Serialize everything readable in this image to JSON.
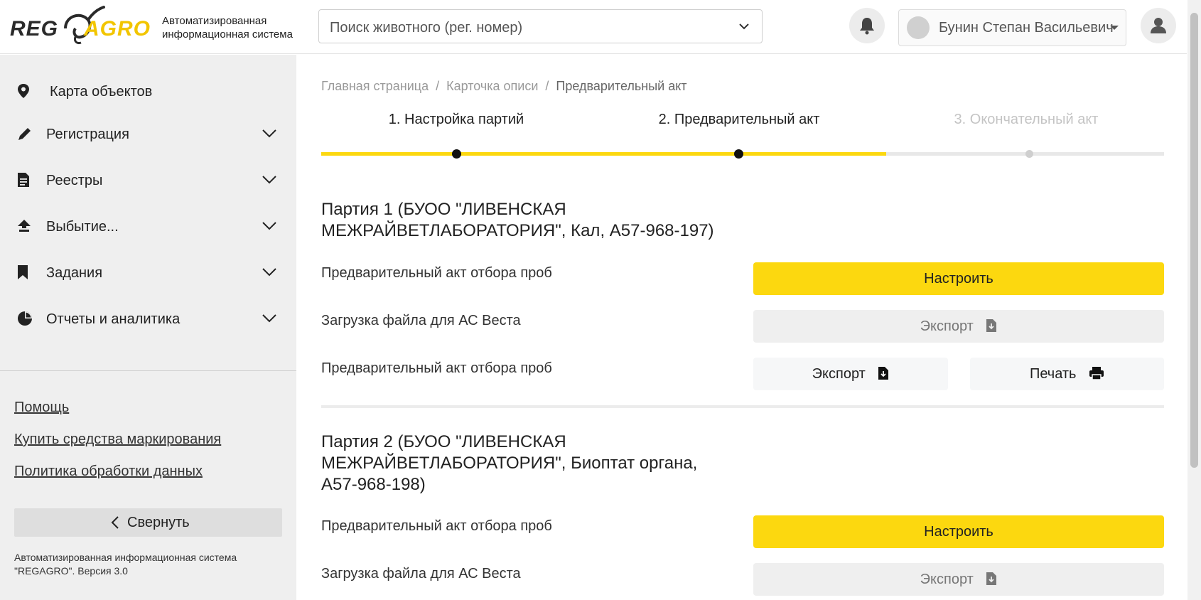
{
  "header": {
    "logo_reg": "REG",
    "logo_agro": "AGRO",
    "brand_line1": "Автоматизированная",
    "brand_line2": "информационная система",
    "search_placeholder": "Поиск животного (рег. номер)",
    "user_name": "Бунин Степан Васильевич"
  },
  "sidebar": {
    "items": [
      {
        "label": "Карта объектов",
        "icon": "map-pin-icon"
      },
      {
        "label": "Регистрация",
        "icon": "pencil-icon"
      },
      {
        "label": "Реестры",
        "icon": "document-icon"
      },
      {
        "label": "Выбытие...",
        "icon": "upload-icon"
      },
      {
        "label": "Задания",
        "icon": "bookmark-icon"
      },
      {
        "label": "Отчеты и аналитика",
        "icon": "pie-chart-icon"
      }
    ],
    "links": [
      "Помощь",
      "Купить средства маркирования",
      "Политика обработки данных"
    ],
    "collapse_label": "Свернуть",
    "footer_line1": "Автоматизированная информационная система",
    "footer_line2": "\"REGAGRO\". Версия 3.0"
  },
  "breadcrumb": [
    "Главная страница",
    "Карточка описи",
    "Предварительный акт"
  ],
  "stepper": {
    "steps": [
      "1. Настройка партий",
      "2. Предварительный акт",
      "3. Окончательный акт"
    ],
    "active_step": 2
  },
  "parties": [
    {
      "title_line1": "Партия 1 (БУОО \"ЛИВЕНСКАЯ",
      "title_line2": "МЕЖРАЙВЕТЛАБОРАТОРИЯ\", Кал, А57-968-197)",
      "title_line3": "",
      "rows": [
        {
          "label": "Предварительный акт отбора проб",
          "button": "Настроить"
        },
        {
          "label": "Загрузка файла для АС Веста",
          "button": "Экспорт"
        },
        {
          "label": "Предварительный акт отбора проб",
          "button": "Экспорт",
          "button2": "Печать"
        }
      ]
    },
    {
      "title_line1": "Партия 2 (БУОО \"ЛИВЕНСКАЯ",
      "title_line2": "МЕЖРАЙВЕТЛАБОРАТОРИЯ\", Биоптат органа,",
      "title_line3": "А57-968-198)",
      "rows": [
        {
          "label": "Предварительный акт отбора проб",
          "button": "Настроить"
        },
        {
          "label": "Загрузка файла для АС Веста",
          "button": "Экспорт"
        }
      ]
    }
  ],
  "colors": {
    "accent": "#fcd80f",
    "sidebar_bg": "#efefef",
    "disabled_btn": "#efefef"
  }
}
